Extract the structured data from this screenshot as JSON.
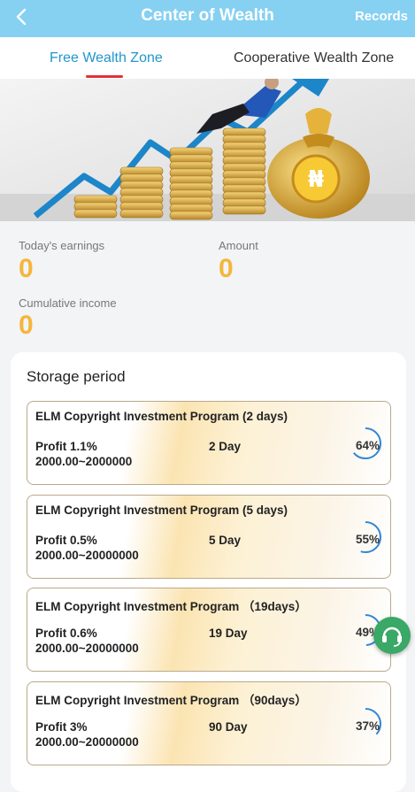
{
  "header": {
    "title": "Center of Wealth",
    "records_label": "Records"
  },
  "tabs": [
    {
      "label": "Free Wealth Zone",
      "active": true
    },
    {
      "label": "Cooperative Wealth Zone",
      "active": false
    }
  ],
  "stats": {
    "today_label": "Today's earnings",
    "today_value": "0",
    "amount_label": "Amount",
    "amount_value": "0",
    "cumulative_label": "Cumulative income",
    "cumulative_value": "0"
  },
  "storage": {
    "title": "Storage period",
    "programs": [
      {
        "name": "ELM Copyright Investment Program (2 days)",
        "profit": "Profit 1.1%",
        "range": "2000.00~2000000",
        "days": "2 Day",
        "percent": "64%",
        "progress": 0.64
      },
      {
        "name": "ELM Copyright Investment Program (5 days)",
        "profit": "Profit 0.5%",
        "range": "2000.00~20000000",
        "days": "5 Day",
        "percent": "55%",
        "progress": 0.55
      },
      {
        "name": "ELM Copyright Investment Program （19days）",
        "profit": "Profit 0.6%",
        "range": "2000.00~20000000",
        "days": "19 Day",
        "percent": "49%",
        "progress": 0.49
      },
      {
        "name": "ELM Copyright Investment Program （90days）",
        "profit": "Profit 3%",
        "range": "2000.00~20000000",
        "days": "90 Day",
        "percent": "37%",
        "progress": 0.37
      }
    ]
  },
  "icons": {
    "back": "back-arrow-icon",
    "support": "customer-support-icon",
    "currency": "naira-icon"
  },
  "colors": {
    "header": "#86d0f2",
    "active_tab": "#2196c9",
    "tab_indicator": "#e5303a",
    "stat_value": "#f4b63c",
    "ring": "#2f86d8",
    "support": "#3aa867"
  }
}
